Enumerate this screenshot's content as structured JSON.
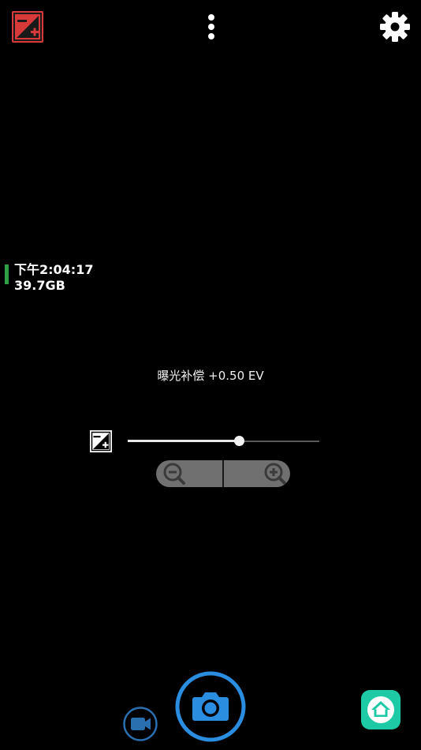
{
  "status": {
    "time": "下午2:04:17",
    "storage": "39.7GB",
    "indicator_color": "#2ea043"
  },
  "exposure": {
    "label": "曝光补偿 +0.50 EV",
    "slider_fraction": 0.58
  },
  "icons": {
    "top_left": "exposure-compensation-icon",
    "top_center": "more-vertical-icon",
    "top_right": "gear-icon",
    "slider_left": "exposure-compensation-icon",
    "zoom_out": "zoom-out-icon",
    "zoom_in": "zoom-in-icon",
    "video": "video-camera-icon",
    "shutter": "camera-icon",
    "home": "home-icon"
  },
  "colors": {
    "accent_red": "#d83a3a",
    "shutter_blue": "#2a8de0",
    "home_teal": "#1ec9a6",
    "video_ring": "#2a6fb0"
  }
}
